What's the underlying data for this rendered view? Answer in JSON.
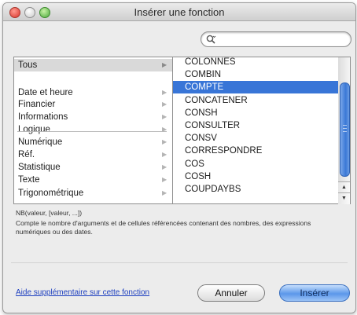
{
  "window": {
    "title": "Insérer une fonction"
  },
  "search": {
    "value": "",
    "placeholder": ""
  },
  "categories": [
    {
      "label": "Tous",
      "selected": true
    },
    {
      "label": "Date et heure"
    },
    {
      "label": "Financier"
    },
    {
      "label": "Informations"
    },
    {
      "label": "Logique"
    },
    {
      "label": "Numérique"
    },
    {
      "label": "Réf."
    },
    {
      "label": "Statistique"
    },
    {
      "label": "Texte"
    },
    {
      "label": "Trigonométrique"
    }
  ],
  "functions": [
    {
      "label": "COLONNES"
    },
    {
      "label": "COMBIN"
    },
    {
      "label": "COMPTE",
      "selected": true
    },
    {
      "label": "CONCATENER"
    },
    {
      "label": "CONSH"
    },
    {
      "label": "CONSULTER"
    },
    {
      "label": "CONSV"
    },
    {
      "label": "CORRESPONDRE"
    },
    {
      "label": "COS"
    },
    {
      "label": "COSH"
    },
    {
      "label": "COUPDAYBS"
    }
  ],
  "detail": {
    "syntax": "NB(valeur, [valeur, ...])",
    "description": "Compte le nombre d'arguments et de cellules référencées contenant des nombres, des expressions numériques ou des dates."
  },
  "footer": {
    "help_link": "Aide supplémentaire sur cette fonction",
    "cancel_label": "Annuler",
    "insert_label": "Insérer"
  },
  "colors": {
    "selection": "#3875d7",
    "category_selected": "#d9d9d9",
    "link": "#1d3fbf"
  }
}
